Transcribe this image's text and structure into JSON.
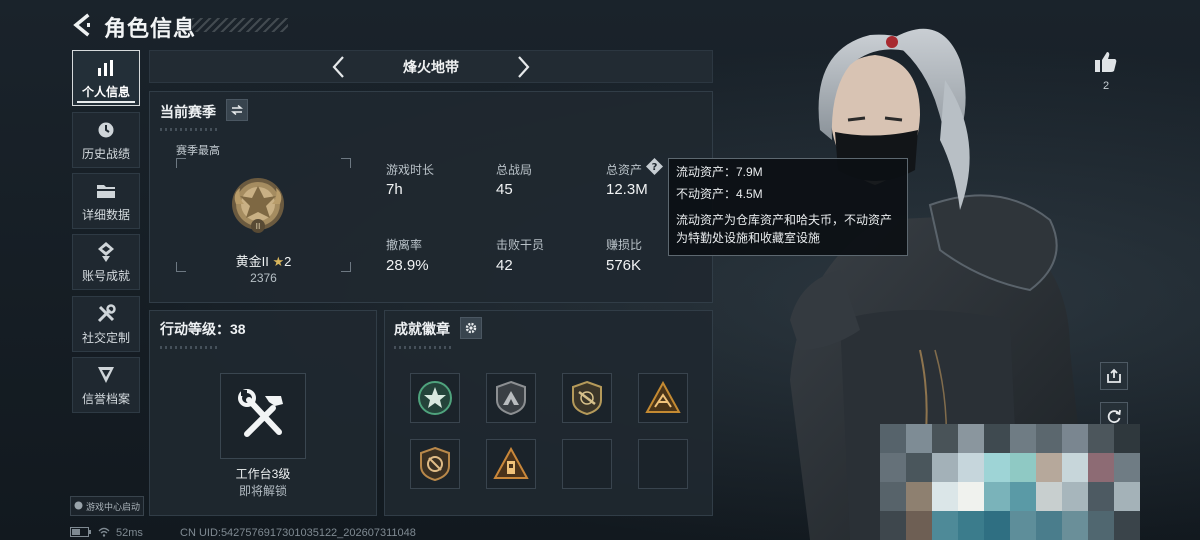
{
  "header": {
    "title": "角色信息"
  },
  "nav": {
    "items": [
      {
        "label": "个人信息",
        "icon": "bar-chart-icon",
        "active": true
      },
      {
        "label": "历史战绩",
        "icon": "clock-icon",
        "active": false
      },
      {
        "label": "详细数据",
        "icon": "folder-icon",
        "active": false
      },
      {
        "label": "账号成就",
        "icon": "medal-icon",
        "active": false
      },
      {
        "label": "社交定制",
        "icon": "tools-icon",
        "active": false
      },
      {
        "label": "信誉档案",
        "icon": "shield-icon",
        "active": false
      }
    ],
    "game_center": "游戏中心启动"
  },
  "mode": {
    "name": "烽火地带"
  },
  "season": {
    "title": "当前赛季",
    "subtitle": "赛季最高",
    "rank_name": "黄金II",
    "rank_stars": "2",
    "rank_score": "2376",
    "stats": [
      {
        "label": "游戏时长",
        "value": "7h"
      },
      {
        "label": "总战局",
        "value": "45"
      },
      {
        "label": "总资产",
        "value": "12.3M"
      },
      {
        "label": "撤离率",
        "value": "28.9%"
      },
      {
        "label": "击败干员",
        "value": "42"
      },
      {
        "label": "赚损比",
        "value": "576K"
      }
    ]
  },
  "tooltip": {
    "liquid": "流动资产：7.9M",
    "fixed": "不动资产：4.5M",
    "desc_line1": "流动资产为仓库资产和哈夫币，不动资产",
    "desc_line2": "为特勤处设施和收藏室设施"
  },
  "action_level": {
    "title": "行动等级：38",
    "workbench_name": "工作台3级",
    "workbench_state": "即将解锁"
  },
  "badges": {
    "title": "成就徽章",
    "items": [
      {
        "icon": "star-badge-icon",
        "color": "#3f8f6a"
      },
      {
        "icon": "mountain-shield-icon",
        "color": "#8c8f92"
      },
      {
        "icon": "rifle-shield-icon",
        "color": "#b59a5a"
      },
      {
        "icon": "bird-triangle-icon",
        "color": "#c48a32"
      },
      {
        "icon": "slash-shield-icon",
        "color": "#b9884a"
      },
      {
        "icon": "tower-triangle-icon",
        "color": "#c9873a"
      },
      {
        "icon": "empty-slot",
        "color": ""
      },
      {
        "icon": "empty-slot",
        "color": ""
      }
    ]
  },
  "social": {
    "like_count": "2"
  },
  "status": {
    "ping": "52ms",
    "uid": "CN UID:5427576917301035122_202607311048"
  }
}
